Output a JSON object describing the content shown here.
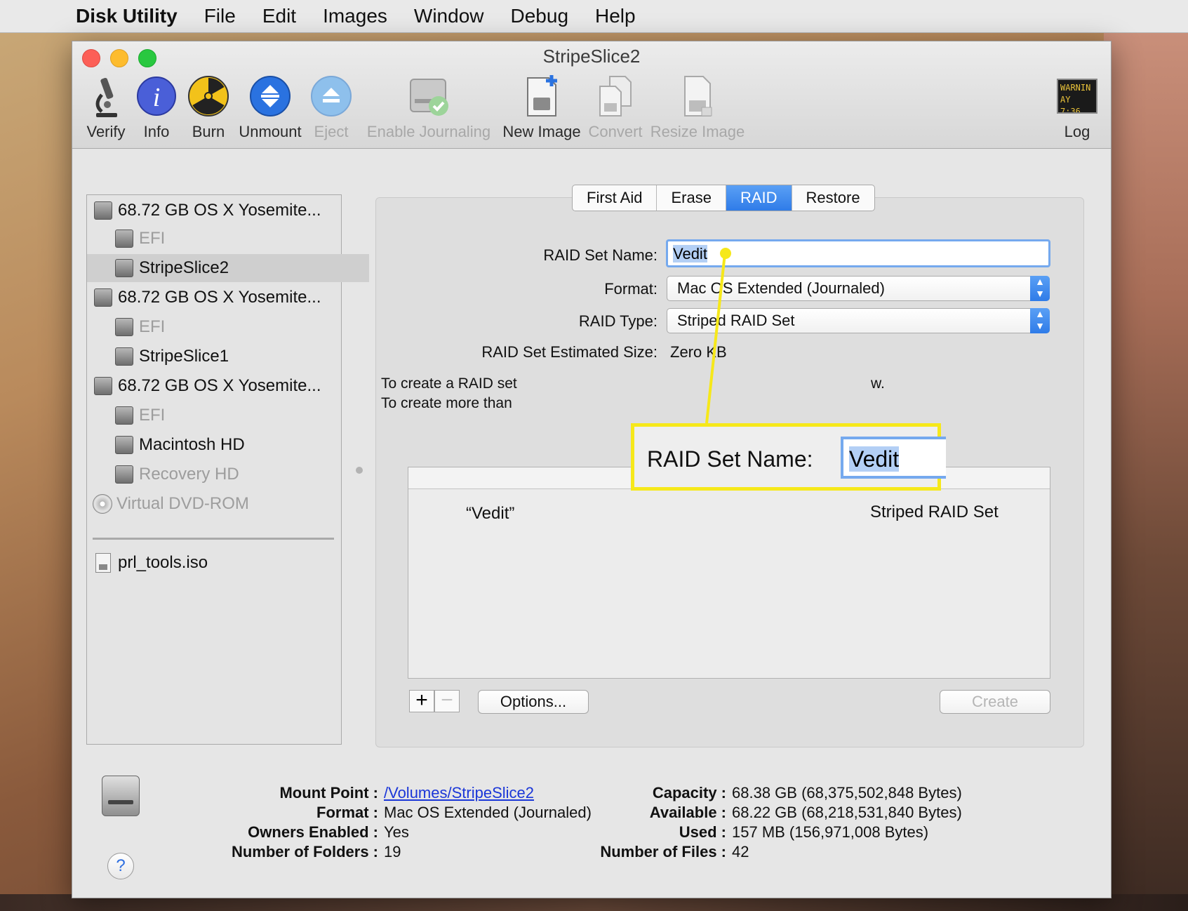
{
  "menubar": {
    "apple": "",
    "app": "Disk Utility",
    "items": [
      "File",
      "Edit",
      "Images",
      "Window",
      "Debug",
      "Help"
    ]
  },
  "window": {
    "title": "StripeSlice2",
    "toolbar": [
      {
        "label": "Verify",
        "icon": "microscope-icon",
        "enabled": true
      },
      {
        "label": "Info",
        "icon": "info-icon",
        "enabled": true
      },
      {
        "label": "Burn",
        "icon": "burn-icon",
        "enabled": true
      },
      {
        "label": "Unmount",
        "icon": "unmount-icon",
        "enabled": true
      },
      {
        "label": "Eject",
        "icon": "eject-icon",
        "enabled": false
      },
      {
        "label": "Enable Journaling",
        "icon": "journaling-icon",
        "enabled": false
      },
      {
        "label": "New Image",
        "icon": "new-image-icon",
        "enabled": true
      },
      {
        "label": "Convert",
        "icon": "convert-icon",
        "enabled": false
      },
      {
        "label": "Resize Image",
        "icon": "resize-image-icon",
        "enabled": false
      },
      {
        "label": "Log",
        "icon": "log-icon",
        "enabled": true
      }
    ],
    "log_icon_text": [
      "WARNIN",
      "AY 7:36"
    ]
  },
  "sidebar": {
    "items": [
      {
        "label": "68.72 GB OS X Yosemite...",
        "level": 0,
        "icon": "disk-icon",
        "dimmed": false,
        "selected": false
      },
      {
        "label": "EFI",
        "level": 1,
        "icon": "volume-icon",
        "dimmed": true,
        "selected": false
      },
      {
        "label": "StripeSlice2",
        "level": 1,
        "icon": "volume-icon",
        "dimmed": false,
        "selected": true
      },
      {
        "label": "68.72 GB OS X Yosemite...",
        "level": 0,
        "icon": "disk-icon",
        "dimmed": false,
        "selected": false
      },
      {
        "label": "EFI",
        "level": 1,
        "icon": "volume-icon",
        "dimmed": true,
        "selected": false
      },
      {
        "label": "StripeSlice1",
        "level": 1,
        "icon": "volume-icon",
        "dimmed": false,
        "selected": false
      },
      {
        "label": "68.72 GB OS X Yosemite...",
        "level": 0,
        "icon": "disk-icon",
        "dimmed": false,
        "selected": false
      },
      {
        "label": "EFI",
        "level": 1,
        "icon": "volume-icon",
        "dimmed": true,
        "selected": false
      },
      {
        "label": "Macintosh HD",
        "level": 1,
        "icon": "volume-icon",
        "dimmed": false,
        "selected": false
      },
      {
        "label": "Recovery HD",
        "level": 1,
        "icon": "volume-icon",
        "dimmed": true,
        "selected": false
      },
      {
        "label": "Virtual DVD-ROM",
        "level": 0,
        "icon": "dvd-icon",
        "dimmed": true,
        "selected": false
      }
    ],
    "images": [
      {
        "label": "prl_tools.iso",
        "icon": "iso-file-icon"
      }
    ]
  },
  "tabs": [
    {
      "label": "First Aid",
      "active": false
    },
    {
      "label": "Erase",
      "active": false
    },
    {
      "label": "RAID",
      "active": true
    },
    {
      "label": "Restore",
      "active": false
    }
  ],
  "raid": {
    "name_label": "RAID Set Name:",
    "name_value": "Vedit",
    "format_label": "Format:",
    "format_value": "Mac OS Extended (Journaled)",
    "type_label": "RAID Type:",
    "type_value": "Striped RAID Set",
    "size_label": "RAID Set Estimated Size:",
    "size_value": "Zero KB",
    "help_line1_start": "To create a RAID set",
    "help_line1_end": "w.",
    "help_line2_start": "To create more than",
    "list": {
      "name": "“Vedit”",
      "type": "Striped RAID Set"
    },
    "add_label": "+",
    "remove_label": "−",
    "options_label": "Options...",
    "create_label": "Create"
  },
  "callout": {
    "label": "RAID Set Name:",
    "value": "Vedit",
    "highlight_color": "#f6e81a"
  },
  "info": {
    "left": [
      {
        "label": "Mount Point :",
        "value": "/Volumes/StripeSlice2",
        "link": true
      },
      {
        "label": "Format :",
        "value": "Mac OS Extended (Journaled)",
        "link": false
      },
      {
        "label": "Owners Enabled :",
        "value": "Yes",
        "link": false
      },
      {
        "label": "Number of Folders :",
        "value": "19",
        "link": false
      }
    ],
    "right": [
      {
        "label": "Capacity :",
        "value": "68.38 GB (68,375,502,848 Bytes)"
      },
      {
        "label": "Available :",
        "value": "68.22 GB (68,218,531,840 Bytes)"
      },
      {
        "label": "Used :",
        "value": "157 MB (156,971,008 Bytes)"
      },
      {
        "label": "Number of Files :",
        "value": "42"
      }
    ],
    "help": "?"
  }
}
